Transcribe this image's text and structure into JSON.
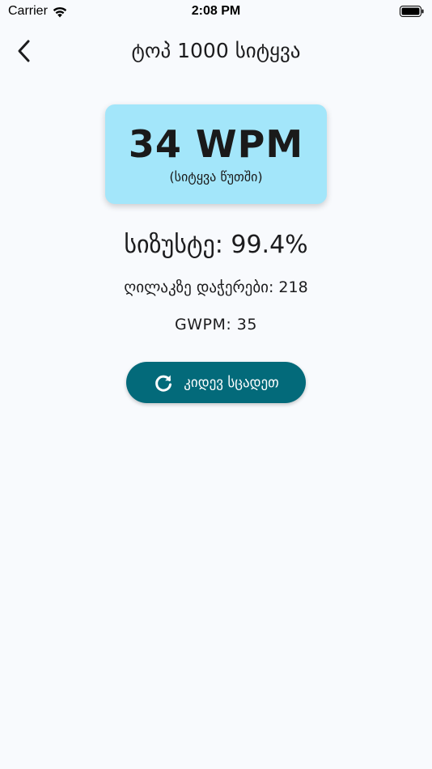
{
  "status_bar": {
    "carrier": "Carrier",
    "time": "2:08 PM",
    "wifi_icon": "wifi-icon",
    "battery_icon": "battery-icon"
  },
  "nav": {
    "back_icon": "chevron-left-icon",
    "title": "ტოპ 1000 სიტყვა"
  },
  "result": {
    "wpm": "34 WPM",
    "wpm_caption": "(სიტყვა წუთში)",
    "accuracy": "სიზუსტე: 99.4%",
    "keystrokes": "ღილაკზე დაჭერები: 218",
    "gwpm": "GWPM: 35"
  },
  "actions": {
    "retry_label": "კიდევ სცადეთ",
    "retry_icon": "refresh-icon"
  },
  "colors": {
    "background": "#f8fafd",
    "card": "#a3e6fa",
    "button": "#036a7a",
    "button_text": "#ffffff"
  }
}
